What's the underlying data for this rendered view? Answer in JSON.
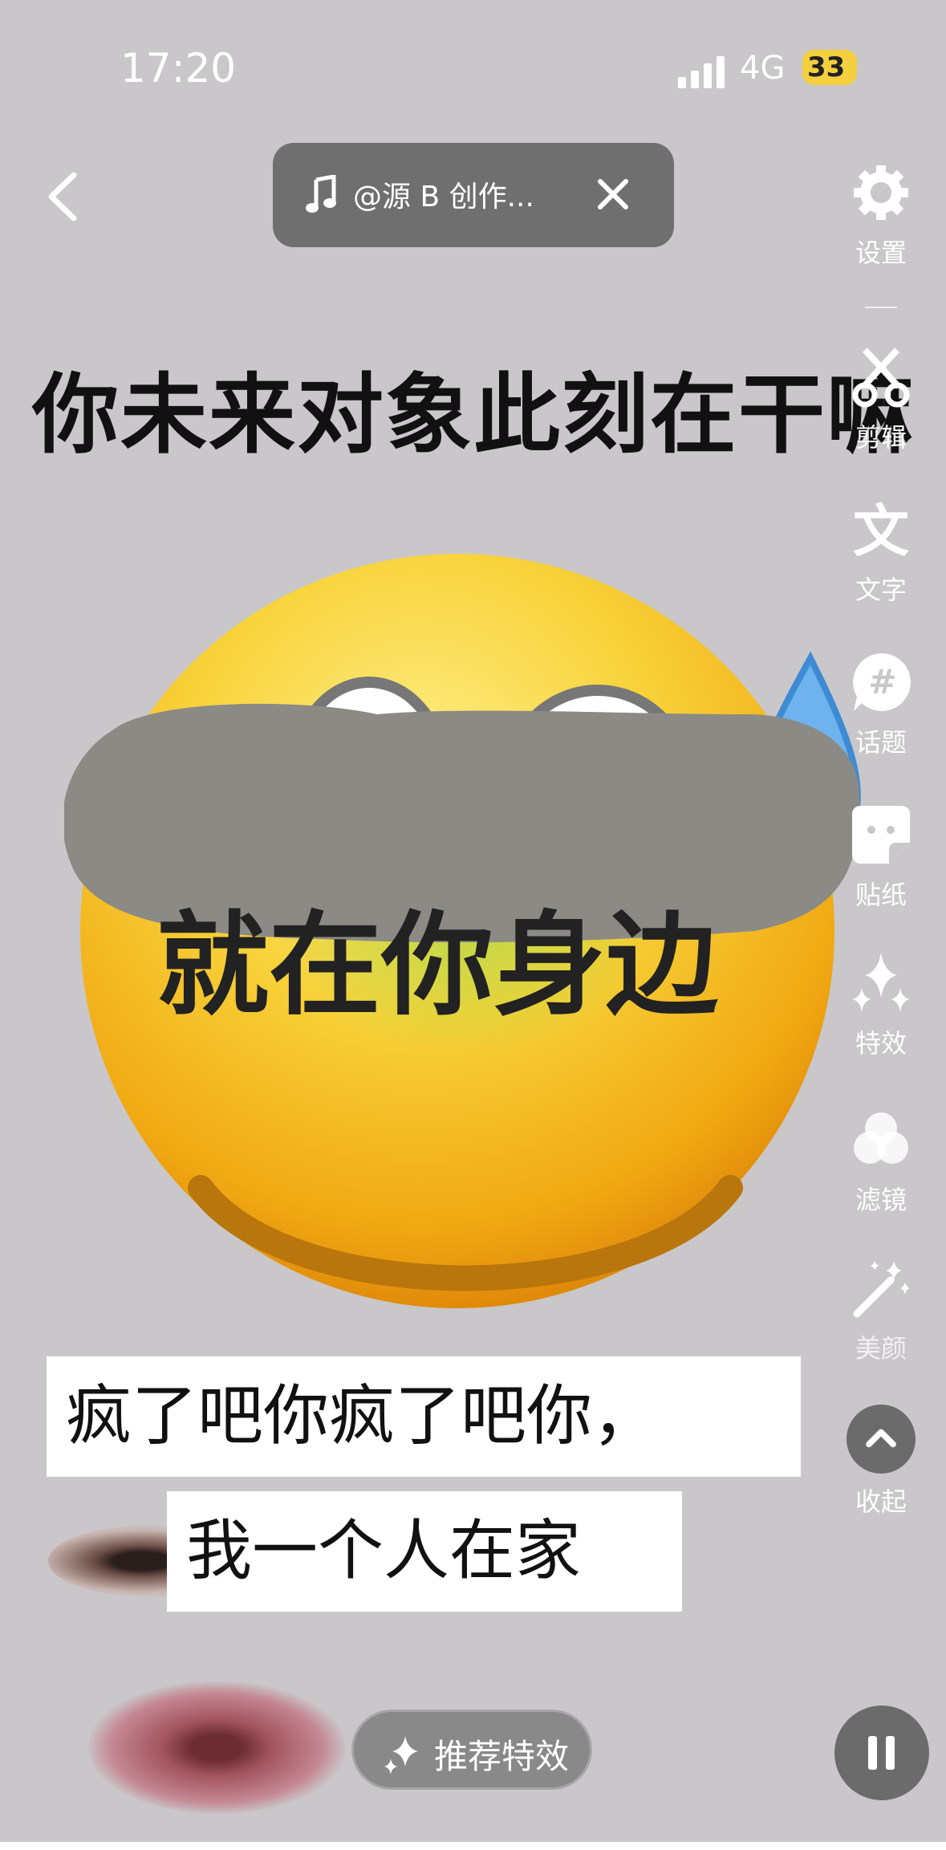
{
  "status_bar": {
    "time": "17:20",
    "network": "4G",
    "battery": "33"
  },
  "music": {
    "title": "@源 B 创作..."
  },
  "sidebar": {
    "items": [
      {
        "label": "设置",
        "icon": "gear-icon"
      },
      {
        "label": "剪辑",
        "icon": "scissors-icon"
      },
      {
        "label": "文字",
        "icon": "text-icon"
      },
      {
        "label": "话题",
        "icon": "hashtag-icon"
      },
      {
        "label": "贴纸",
        "icon": "sticker-icon"
      },
      {
        "label": "特效",
        "icon": "sparkle-icon"
      },
      {
        "label": "滤镜",
        "icon": "filter-icon"
      },
      {
        "label": "美颜",
        "icon": "magic-wand-icon"
      },
      {
        "label": "收起",
        "icon": "chevron-up-icon"
      }
    ]
  },
  "canvas": {
    "headline": "你未来对象此刻在干嘛",
    "emoji_text": "就在你身边",
    "caption_line1": "疯了吧你疯了吧你，",
    "caption_line2": "我一个人在家"
  },
  "bottom": {
    "recommend_label": "推荐特效"
  },
  "colors": {
    "background": "#c9c7c9",
    "pill": "#6f6f70",
    "emoji_yellow": "#f5c016",
    "censor_gray": "#8b8a84",
    "battery": "#f4d03f"
  }
}
